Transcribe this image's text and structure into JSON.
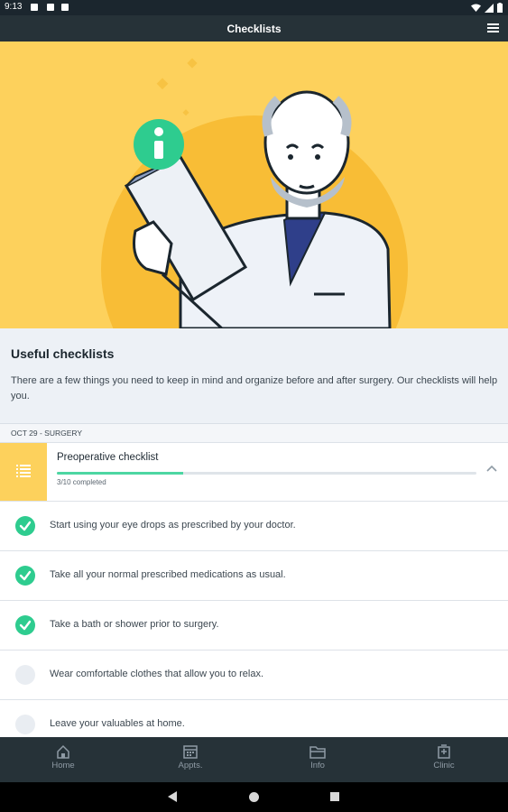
{
  "status_bar": {
    "time": "9:13"
  },
  "app_bar": {
    "title": "Checklists",
    "menu_icon": "menu-icon"
  },
  "intro": {
    "heading": "Useful checklists",
    "description": "There are a few things you need to keep in mind and organize before and after surgery. Our checklists will help you."
  },
  "section": {
    "label": "OCT 29 - SURGERY"
  },
  "checklist": {
    "title": "Preoperative checklist",
    "completed_text": "3/10 completed",
    "progress": 0.3,
    "items": [
      {
        "text": "Start using your eye drops as prescribed by your doctor.",
        "done": true
      },
      {
        "text": "Take all your normal prescribed medications as usual.",
        "done": true
      },
      {
        "text": "Take a bath or shower prior to surgery.",
        "done": true
      },
      {
        "text": "Wear comfortable clothes that allow you to relax.",
        "done": false
      },
      {
        "text": "Leave your valuables at home.",
        "done": false
      }
    ]
  },
  "bottom_nav": [
    {
      "label": "Home",
      "icon": "home-icon"
    },
    {
      "label": "Appts.",
      "icon": "calendar-icon"
    },
    {
      "label": "Info",
      "icon": "folder-icon"
    },
    {
      "label": "Clinic",
      "icon": "clinic-icon"
    }
  ],
  "colors": {
    "accent_yellow": "#fdd15c",
    "check_green": "#2ecc8f",
    "progress_green": "#4dd6a2",
    "dark_bar": "#263238"
  }
}
